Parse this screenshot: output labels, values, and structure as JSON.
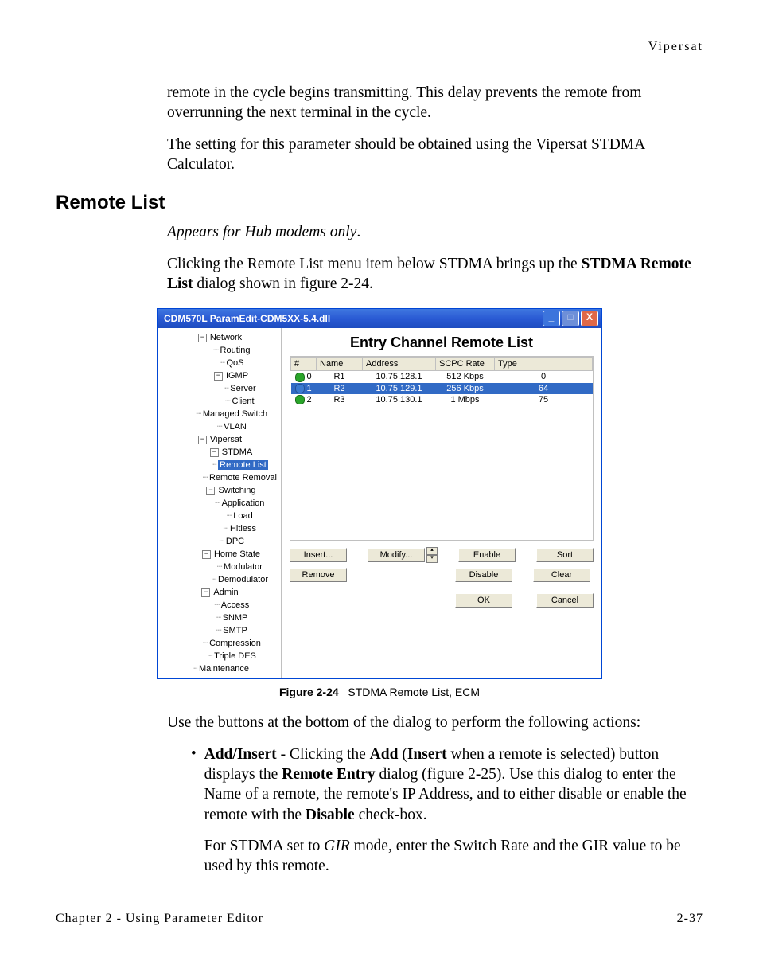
{
  "header": {
    "running": "Vipersat"
  },
  "paras": {
    "p1": "remote in the cycle begins transmitting. This delay prevents the remote from overrunning the next terminal in the cycle.",
    "p2": "The setting for this parameter should be obtained using the Vipersat STDMA Calculator.",
    "heading": "Remote List",
    "hub_only": "Appears for Hub modems only",
    "p3a": "Clicking the Remote List menu item below STDMA brings up the ",
    "p3b": "STDMA Remote List",
    "p3c": " dialog shown in figure 2-24.",
    "after_fig": "Use the buttons at the bottom of the dialog to perform the following actions:",
    "bullet_lead1": "Add/Insert",
    "bullet_mid1": " - Clicking the ",
    "bullet_add": "Add",
    "bullet_paren1": " (",
    "bullet_insert": "Insert",
    "bullet_rest1": " when a remote is selected) button displays the ",
    "bullet_remote_entry": "Remote Entry",
    "bullet_rest2": " dialog (figure 2-25). Use this dialog to enter the Name of a remote, the remote's IP Address, and to either disable or enable the remote with the ",
    "bullet_disable": "Disable",
    "bullet_rest3": " check-box.",
    "sub1a": "For STDMA set to ",
    "sub1_gir": "GIR",
    "sub1b": " mode, enter the Switch Rate and the GIR value to be used by this remote."
  },
  "figure": {
    "label": "Figure 2-24",
    "caption": "STDMA Remote List, ECM"
  },
  "window": {
    "title": "CDM570L ParamEdit-CDM5XX-5.4.dll",
    "panel_heading": "Entry Channel Remote List",
    "columns": [
      "#",
      "Name",
      "Address",
      "SCPC Rate",
      "Type"
    ],
    "rows": [
      {
        "idx": "0",
        "name": "R1",
        "addr": "10.75.128.1",
        "rate": "512 Kbps",
        "type": "0",
        "dot": "green",
        "sel": false
      },
      {
        "idx": "1",
        "name": "R2",
        "addr": "10.75.129.1",
        "rate": "256 Kbps",
        "type": "64",
        "dot": "blue",
        "sel": true
      },
      {
        "idx": "2",
        "name": "R3",
        "addr": "10.75.130.1",
        "rate": "1 Mbps",
        "type": "75",
        "dot": "green",
        "sel": false
      }
    ],
    "buttons": {
      "insert": "Insert...",
      "modify": "Modify...",
      "enable": "Enable",
      "sort": "Sort",
      "remove": "Remove",
      "disable": "Disable",
      "clear": "Clear",
      "ok": "OK",
      "cancel": "Cancel"
    },
    "tree": [
      {
        "lvl": 0,
        "exp": "-",
        "label": "Network"
      },
      {
        "lvl": 1,
        "exp": "",
        "label": "Routing"
      },
      {
        "lvl": 1,
        "exp": "",
        "label": "QoS"
      },
      {
        "lvl": 1,
        "exp": "-",
        "label": "IGMP"
      },
      {
        "lvl": 2,
        "exp": "",
        "label": "Server"
      },
      {
        "lvl": 2,
        "exp": "",
        "label": "Client"
      },
      {
        "lvl": 1,
        "exp": "",
        "label": "Managed Switch"
      },
      {
        "lvl": 1,
        "exp": "",
        "label": "VLAN"
      },
      {
        "lvl": 0,
        "exp": "-",
        "label": "Vipersat"
      },
      {
        "lvl": 1,
        "exp": "-",
        "label": "STDMA"
      },
      {
        "lvl": 2,
        "exp": "",
        "label": "Remote List",
        "sel": true
      },
      {
        "lvl": 2,
        "exp": "",
        "label": "Remote Removal"
      },
      {
        "lvl": 1,
        "exp": "-",
        "label": "Switching"
      },
      {
        "lvl": 2,
        "exp": "",
        "label": "Application"
      },
      {
        "lvl": 2,
        "exp": "",
        "label": "Load"
      },
      {
        "lvl": 2,
        "exp": "",
        "label": "Hitless"
      },
      {
        "lvl": 1,
        "exp": "",
        "label": "DPC"
      },
      {
        "lvl": 1,
        "exp": "-",
        "label": "Home State"
      },
      {
        "lvl": 2,
        "exp": "",
        "label": "Modulator"
      },
      {
        "lvl": 2,
        "exp": "",
        "label": "Demodulator"
      },
      {
        "lvl": 0,
        "exp": "-",
        "label": "Admin"
      },
      {
        "lvl": 1,
        "exp": "",
        "label": "Access"
      },
      {
        "lvl": 1,
        "exp": "",
        "label": "SNMP"
      },
      {
        "lvl": 1,
        "exp": "",
        "label": "SMTP"
      },
      {
        "lvl": 1,
        "exp": "",
        "label": "Compression"
      },
      {
        "lvl": 1,
        "exp": "",
        "label": "Triple DES"
      },
      {
        "lvl": 0,
        "exp": "",
        "label": "Maintenance"
      }
    ]
  },
  "footer": {
    "left": "Chapter 2 - Using Parameter Editor",
    "right": "2-37"
  }
}
